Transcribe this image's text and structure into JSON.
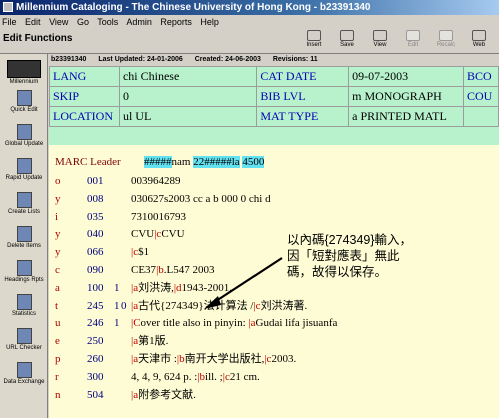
{
  "window": {
    "title": "Millennium Cataloging - The Chinese University of Hong Kong - b23391340"
  },
  "menu": [
    "File",
    "Edit",
    "View",
    "Go",
    "Tools",
    "Admin",
    "Reports",
    "Help"
  ],
  "toolbar": {
    "title": "Edit Functions",
    "buttons": [
      {
        "label": "Insert",
        "icon": "insert-icon",
        "disabled": false
      },
      {
        "label": "Save",
        "icon": "save-icon",
        "disabled": false
      },
      {
        "label": "View",
        "icon": "view-icon",
        "disabled": false
      },
      {
        "label": "Edit",
        "icon": "edit-icon",
        "disabled": true
      },
      {
        "label": "Recalc",
        "icon": "recalc-icon",
        "disabled": true
      },
      {
        "label": "Web",
        "icon": "web-icon",
        "disabled": false
      }
    ]
  },
  "sidebar": {
    "brand": "Millennium",
    "items": [
      {
        "label": "Quick Edit",
        "icon": "quick-edit-icon"
      },
      {
        "label": "Global Update",
        "icon": "global-update-icon"
      },
      {
        "label": "Rapid Update",
        "icon": "rapid-update-icon"
      },
      {
        "label": "Create Lists",
        "icon": "create-lists-icon"
      },
      {
        "label": "Delete Items",
        "icon": "delete-items-icon"
      },
      {
        "label": "Headings Rpts",
        "icon": "headings-reports-icon"
      },
      {
        "label": "Statistics",
        "icon": "statistics-icon"
      },
      {
        "label": "URL Checker",
        "icon": "url-checker-icon"
      },
      {
        "label": "Data Exchange",
        "icon": "data-exchange-icon"
      }
    ]
  },
  "status": {
    "record": "b23391340",
    "last_updated": "Last Updated: 24-01-2006",
    "created": "Created: 24-06-2003",
    "revisions": "Revisions: 11"
  },
  "fixed_fields": [
    {
      "label": "LANG",
      "value": "chi  Chinese",
      "label2": "CAT DATE",
      "value2": "09-07-2003",
      "label3": "BCO"
    },
    {
      "label": "SKIP",
      "value": "0",
      "label2": "BIB LVL",
      "value2": "m  MONOGRAPH",
      "label3": "COU"
    },
    {
      "label": "LOCATION",
      "value": "ul    UL",
      "label2": "MAT TYPE",
      "value2": "a  PRINTED MATL",
      "label3": ""
    }
  ],
  "marc": {
    "leader_label": "MARC Leader",
    "leader_hash1": "#####",
    "leader_mid": "nam  ",
    "leader_hl2": "22#####la",
    "leader_end": "4500",
    "rows": [
      {
        "ind": "o",
        "tag": "001",
        "i1": "",
        "i2": "",
        "content": "003964289"
      },
      {
        "ind": "y",
        "tag": "008",
        "i1": "",
        "i2": "",
        "content": "030627s2003    cc a     b     000 0 chi d"
      },
      {
        "ind": "i",
        "tag": "035",
        "i1": "",
        "i2": "",
        "content": "7310016793"
      },
      {
        "ind": "y",
        "tag": "040",
        "i1": "",
        "i2": "",
        "content": "CVU|cCVU"
      },
      {
        "ind": "y",
        "tag": "066",
        "i1": "",
        "i2": "",
        "content": "|c$1"
      },
      {
        "ind": "c",
        "tag": "090",
        "i1": "",
        "i2": "",
        "content": "CE37|b.L547 2003"
      },
      {
        "ind": "a",
        "tag": "100",
        "i1": "1",
        "i2": "",
        "content": "|a刘洪涛,|d1943-2001."
      },
      {
        "ind": "t",
        "tag": "245",
        "i1": "1",
        "i2": "0",
        "content": "|a古代{274349}法计算法 /|c刘洪涛著."
      },
      {
        "ind": "u",
        "tag": "246",
        "i1": "1",
        "i2": "",
        "content": "|Cover title also in pinyin: |aGudai lifa jisuanfa"
      },
      {
        "ind": "e",
        "tag": "250",
        "i1": "",
        "i2": "",
        "content": "|a第1版."
      },
      {
        "ind": "p",
        "tag": "260",
        "i1": "",
        "i2": "",
        "content": "|a天津市 :|b南开大学出版社,|c2003."
      },
      {
        "ind": "r",
        "tag": "300",
        "i1": "",
        "i2": "",
        "content": "4, 4, 9, 624 p. :|bill. ;|c21 cm."
      },
      {
        "ind": "n",
        "tag": "504",
        "i1": "",
        "i2": "",
        "content": "|a附参考文献."
      }
    ]
  },
  "annotation": {
    "line1": "以內碼{274349}輸入，",
    "line2": "因「短對應表」無此",
    "line3": "碼，故得以保存。"
  },
  "colors": {
    "fixed_bg": "#b8f2cc",
    "var_bg": "#fefcd4",
    "label_blue": "#0000b5",
    "subfield_red": "#c00000",
    "highlight": "#62e1f0"
  }
}
